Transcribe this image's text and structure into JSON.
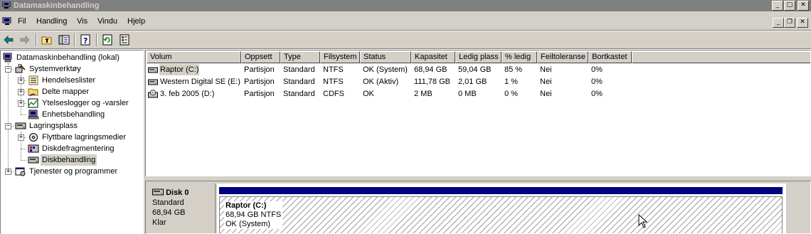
{
  "window": {
    "title": "Datamaskinbehandling"
  },
  "menu": {
    "items": [
      "Fil",
      "Handling",
      "Vis",
      "Vindu",
      "Hjelp"
    ]
  },
  "toolbar": {
    "buttons": [
      "back-arrow-icon",
      "forward-arrow-icon",
      "up-folder-icon",
      "show-hide-tree-icon",
      "help-icon",
      "refresh-icon",
      "properties-icon"
    ]
  },
  "tree": {
    "root": "Datamaskinbehandling (lokal)",
    "systemtools": "Systemverktøy",
    "eventviewer": "Hendelseslister",
    "sharedfolders": "Delte mapper",
    "perflogs": "Ytelseslogger og -varsler",
    "devicemanager": "Enhetsbehandling",
    "storage": "Lagringsplass",
    "removable": "Flyttbare lagringsmedier",
    "defrag": "Diskdefragmentering",
    "diskmgmt": "Diskbehandling",
    "services": "Tjenester og programmer"
  },
  "volumes": {
    "columns": [
      "Volum",
      "Oppsett",
      "Type",
      "Filsystem",
      "Status",
      "Kapasitet",
      "Ledig plass",
      "% ledig",
      "Feiltoleranse",
      "Bortkastet"
    ],
    "rows": [
      {
        "name": "Raptor (C:)",
        "layout": "Partisjon",
        "type": "Standard",
        "fs": "NTFS",
        "status": "OK (System)",
        "capacity": "68,94 GB",
        "free": "59,04 GB",
        "pct": "85 %",
        "fault": "Nei",
        "overhead": "0%",
        "icon": "hard-drive-icon"
      },
      {
        "name": "Western Digital SE (E:)",
        "layout": "Partisjon",
        "type": "Standard",
        "fs": "NTFS",
        "status": "OK (Aktiv)",
        "capacity": "111,78 GB",
        "free": "2,01 GB",
        "pct": "1 %",
        "fault": "Nei",
        "overhead": "0%",
        "icon": "hard-drive-icon"
      },
      {
        "name": "3. feb 2005 (D:)",
        "layout": "Partisjon",
        "type": "Standard",
        "fs": "CDFS",
        "status": "OK",
        "capacity": "2 MB",
        "free": "0 MB",
        "pct": "0 %",
        "fault": "Nei",
        "overhead": "0%",
        "icon": "cd-drive-icon"
      }
    ]
  },
  "disk": {
    "name": "Disk 0",
    "type": "Standard",
    "size": "68,94 GB",
    "state": "Klar",
    "partition": {
      "name": "Raptor  (C:)",
      "size_fs": "68,94 GB NTFS",
      "status": "OK (System)",
      "bar_color": "#000080"
    }
  },
  "colors": {
    "titlebar_inactive": "#808080",
    "face": "#d4d0c8",
    "primary_partition": "#000080"
  }
}
